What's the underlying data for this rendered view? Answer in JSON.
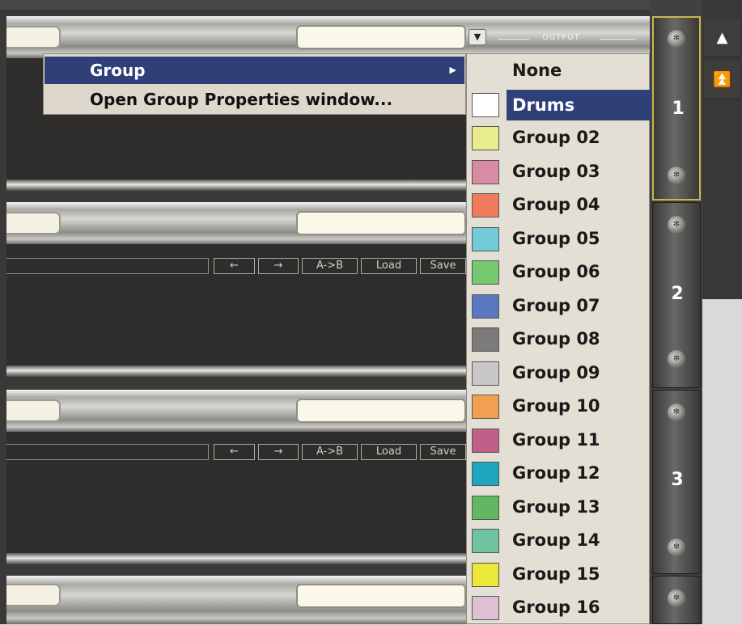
{
  "output_label": "OUTPUT",
  "dropdown_glyph": "▼",
  "module_numbers": [
    "1",
    "2",
    "3"
  ],
  "screw_glyph": "✻",
  "transport_buttons": [
    "←",
    "→",
    "A->B",
    "Load",
    "Save"
  ],
  "scroll_buttons": {
    "up": "▲",
    "top": "⏫"
  },
  "context_menu": {
    "items": [
      {
        "label": "Group",
        "highlighted": true,
        "submenu_arrow": "▶"
      },
      {
        "label": "Open Group Properties window...",
        "highlighted": false
      }
    ]
  },
  "group_submenu": {
    "items": [
      {
        "label": "None",
        "color": null
      },
      {
        "label": "Drums",
        "color": "#ffffff",
        "selected": true
      },
      {
        "label": "Group 02",
        "color": "#e8ec8a"
      },
      {
        "label": "Group 03",
        "color": "#d88ca4"
      },
      {
        "label": "Group 04",
        "color": "#f07a5c"
      },
      {
        "label": "Group 05",
        "color": "#74cbd8"
      },
      {
        "label": "Group 06",
        "color": "#76c86e"
      },
      {
        "label": "Group 07",
        "color": "#5a78c0"
      },
      {
        "label": "Group 08",
        "color": "#7d7a7a"
      },
      {
        "label": "Group 09",
        "color": "#c9c7c9"
      },
      {
        "label": "Group 10",
        "color": "#f0a050"
      },
      {
        "label": "Group 11",
        "color": "#c06088"
      },
      {
        "label": "Group 12",
        "color": "#1ca6c0"
      },
      {
        "label": "Group 13",
        "color": "#62b860"
      },
      {
        "label": "Group 14",
        "color": "#6ec4a0"
      },
      {
        "label": "Group 15",
        "color": "#ece83a"
      },
      {
        "label": "Group 16",
        "color": "#dec0d2"
      }
    ]
  },
  "colors": {
    "menu_highlight": "#2f3f78",
    "selection_frame": "#c8b84a"
  }
}
